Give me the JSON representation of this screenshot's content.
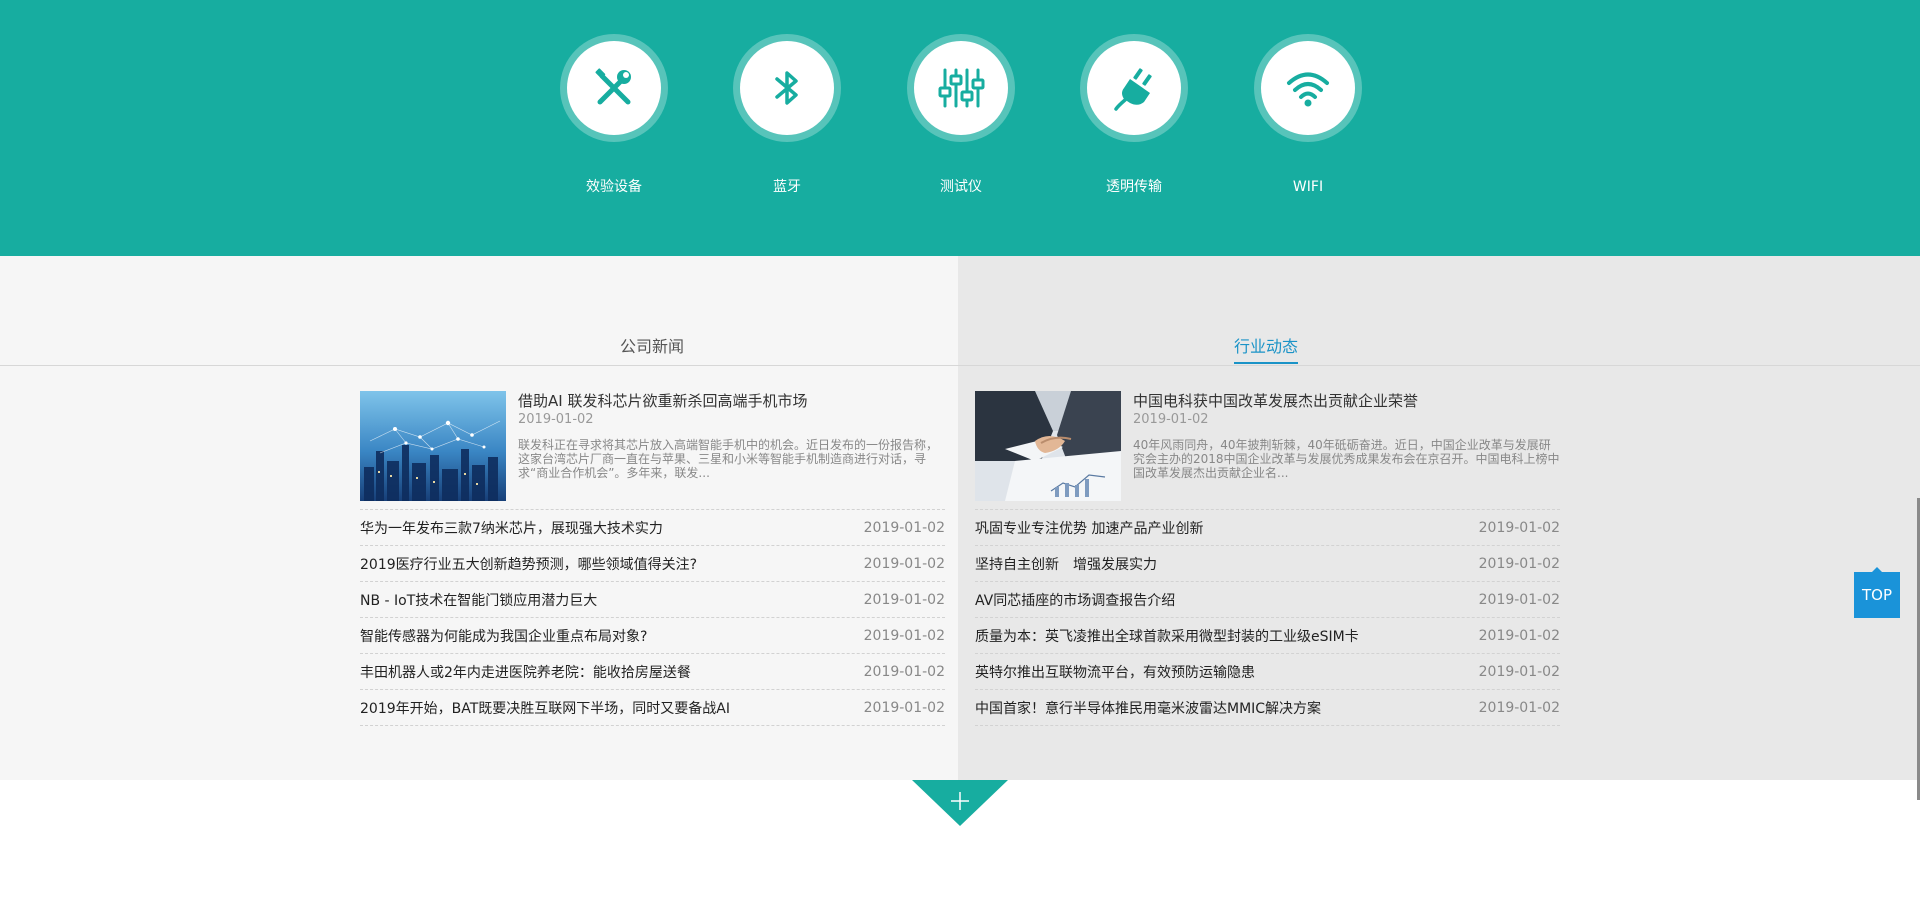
{
  "services": [
    {
      "label": "效验设备",
      "icon": "tools-icon"
    },
    {
      "label": "蓝牙",
      "icon": "bluetooth-icon"
    },
    {
      "label": "测试仪",
      "icon": "sliders-icon"
    },
    {
      "label": "透明传输",
      "icon": "plug-icon"
    },
    {
      "label": "WIFI",
      "icon": "wifi-icon"
    }
  ],
  "tabs": {
    "company": "公司新闻",
    "industry": "行业动态"
  },
  "company": {
    "featured": {
      "title": "借助AI 联发科芯片欲重新杀回高端手机市场",
      "date": "2019-01-02",
      "desc": "联发科正在寻求将其芯片放入高端智能手机中的机会。近日发布的一份报告称，这家台湾芯片厂商一直在与苹果、三星和小米等智能手机制造商进行对话，寻求“商业合作机会”。多年来，联发...",
      "image": "city-network-image"
    },
    "items": [
      {
        "title": "华为一年发布三款7纳米芯片，展现强大技术实力",
        "date": "2019-01-02"
      },
      {
        "title": "2019医疗行业五大创新趋势预测，哪些领域值得关注?",
        "date": "2019-01-02"
      },
      {
        "title": "NB - IoT技术在智能门锁应用潜力巨大",
        "date": "2019-01-02"
      },
      {
        "title": "智能传感器为何能成为我国企业重点布局对象?",
        "date": "2019-01-02"
      },
      {
        "title": "丰田机器人或2年内走进医院养老院：能收拾房屋送餐",
        "date": "2019-01-02"
      },
      {
        "title": "2019年开始，BAT既要决胜互联网下半场，同时又要备战AI",
        "date": "2019-01-02"
      }
    ]
  },
  "industry": {
    "featured": {
      "title": "中国电科获中国改革发展杰出贡献企业荣誉",
      "date": "2019-01-02",
      "desc": "40年风雨同舟，40年披荆斩棘，40年砥砺奋进。近日，中国企业改革与发展研究会主办的2018中国企业改革与发展优秀成果发布会在京召开。中国电科上榜中国改革发展杰出贡献企业名...",
      "image": "handshake-image"
    },
    "items": [
      {
        "title": "巩固专业专注优势 加速产品产业创新",
        "date": "2019-01-02"
      },
      {
        "title": "坚持自主创新　增强发展实力",
        "date": "2019-01-02"
      },
      {
        "title": "AV同芯插座的市场调查报告介绍",
        "date": "2019-01-02"
      },
      {
        "title": "质量为本：英飞凌推出全球首款采用微型封装的工业级eSIM卡",
        "date": "2019-01-02"
      },
      {
        "title": "英特尔推出互联物流平台，有效预防运输隐患",
        "date": "2019-01-02"
      },
      {
        "title": "中国首家！意行半导体推民用毫米波雷达MMIC解决方案",
        "date": "2019-01-02"
      }
    ]
  },
  "controls": {
    "top_label": "TOP",
    "more_icon": "plus-icon"
  },
  "colors": {
    "brand_teal": "#17ada0",
    "accent_blue": "#1a93c7",
    "top_button": "#1a93d9"
  }
}
